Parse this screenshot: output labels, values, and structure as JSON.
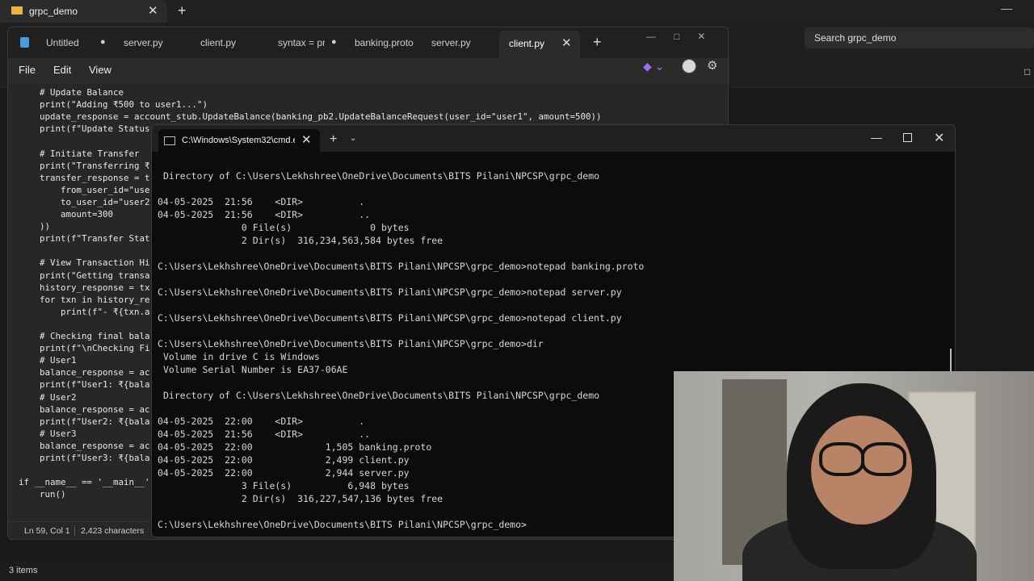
{
  "explorer": {
    "tab_title": "grpc_demo",
    "search_placeholder": "Search grpc_demo",
    "status_text": "3 items",
    "close_glyph": "✕",
    "new_tab_glyph": "+"
  },
  "notepad": {
    "tabs": [
      {
        "label": "Untitled",
        "modified": true
      },
      {
        "label": "server.py",
        "modified": false
      },
      {
        "label": "client.py",
        "modified": false
      },
      {
        "label": "syntax = pr",
        "modified": true
      },
      {
        "label": "banking.proto",
        "modified": false
      },
      {
        "label": "server.py",
        "modified": false
      }
    ],
    "modified_dot": "●",
    "active_tab": "client.py",
    "menu": [
      "File",
      "Edit",
      "View"
    ],
    "code_lines": [
      "    # Update Balance",
      "    print(\"Adding ₹500 to user1...\")",
      "    update_response = account_stub.UpdateBalance(banking_pb2.UpdateBalanceRequest(user_id=\"user1\", amount=500))",
      "    print(f\"Update Status",
      "",
      "    # Initiate Transfer",
      "    print(\"Transferring ₹",
      "    transfer_response = t",
      "        from_user_id=\"use",
      "        to_user_id=\"user2",
      "        amount=300",
      "    ))",
      "    print(f\"Transfer Stat",
      "",
      "    # View Transaction Hi",
      "    print(\"Getting transa",
      "    history_response = tx",
      "    for txn in history_re",
      "        print(f\"- ₹{txn.a",
      "",
      "    # Checking final bala",
      "    print(f\"\\nChecking Fi",
      "    # User1",
      "    balance_response = ac",
      "    print(f\"User1: ₹{bala",
      "    # User2",
      "    balance_response = ac",
      "    print(f\"User2: ₹{bala",
      "    # User3",
      "    balance_response = ac",
      "    print(f\"User3: ₹{bala",
      "",
      "if __name__ == '__main__':",
      "    run()"
    ],
    "status": {
      "position": "Ln 59, Col 1",
      "chars": "2,423 characters"
    }
  },
  "terminal": {
    "tab_title": "C:\\Windows\\System32\\cmd.exe",
    "lines": [
      {
        "indent": 1,
        "text": "Directory of C:\\Users\\Lekhshree\\OneDrive\\Documents\\BITS Pilani\\NPCSP\\grpc_demo"
      },
      {
        "indent": 0,
        "text": ""
      },
      {
        "indent": 0,
        "text": "04-05-2025  21:56    <DIR>          ."
      },
      {
        "indent": 0,
        "text": "04-05-2025  21:56    <DIR>          .."
      },
      {
        "indent": 0,
        "text": "               0 File(s)              0 bytes"
      },
      {
        "indent": 0,
        "text": "               2 Dir(s)  316,234,563,584 bytes free"
      },
      {
        "indent": 0,
        "text": ""
      },
      {
        "indent": 0,
        "text": "C:\\Users\\Lekhshree\\OneDrive\\Documents\\BITS Pilani\\NPCSP\\grpc_demo>notepad banking.proto"
      },
      {
        "indent": 0,
        "text": ""
      },
      {
        "indent": 0,
        "text": "C:\\Users\\Lekhshree\\OneDrive\\Documents\\BITS Pilani\\NPCSP\\grpc_demo>notepad server.py"
      },
      {
        "indent": 0,
        "text": ""
      },
      {
        "indent": 0,
        "text": "C:\\Users\\Lekhshree\\OneDrive\\Documents\\BITS Pilani\\NPCSP\\grpc_demo>notepad client.py"
      },
      {
        "indent": 0,
        "text": ""
      },
      {
        "indent": 0,
        "text": "C:\\Users\\Lekhshree\\OneDrive\\Documents\\BITS Pilani\\NPCSP\\grpc_demo>dir"
      },
      {
        "indent": 1,
        "text": "Volume in drive C is Windows"
      },
      {
        "indent": 1,
        "text": "Volume Serial Number is EA37-06AE"
      },
      {
        "indent": 0,
        "text": ""
      },
      {
        "indent": 1,
        "text": "Directory of C:\\Users\\Lekhshree\\OneDrive\\Documents\\BITS Pilani\\NPCSP\\grpc_demo"
      },
      {
        "indent": 0,
        "text": ""
      },
      {
        "indent": 0,
        "text": "04-05-2025  22:00    <DIR>          ."
      },
      {
        "indent": 0,
        "text": "04-05-2025  21:56    <DIR>          .."
      },
      {
        "indent": 0,
        "text": "04-05-2025  22:00             1,505 banking.proto"
      },
      {
        "indent": 0,
        "text": "04-05-2025  22:00             2,499 client.py"
      },
      {
        "indent": 0,
        "text": "04-05-2025  22:00             2,944 server.py"
      },
      {
        "indent": 0,
        "text": "               3 File(s)          6,948 bytes"
      },
      {
        "indent": 0,
        "text": "               2 Dir(s)  316,227,547,136 bytes free"
      },
      {
        "indent": 0,
        "text": ""
      },
      {
        "indent": 0,
        "text": "C:\\Users\\Lekhshree\\OneDrive\\Documents\\BITS Pilani\\NPCSP\\grpc_demo>"
      }
    ]
  },
  "icons": {
    "folder": "folder-icon",
    "notepad": "notepad-icon",
    "copilot": "copilot-icon",
    "settings": "gear-icon",
    "terminal": "cmd-icon"
  },
  "colors": {
    "terminal_bg": "#0c0c0c",
    "notepad_bg": "#272727",
    "folder": "#e8b545"
  }
}
